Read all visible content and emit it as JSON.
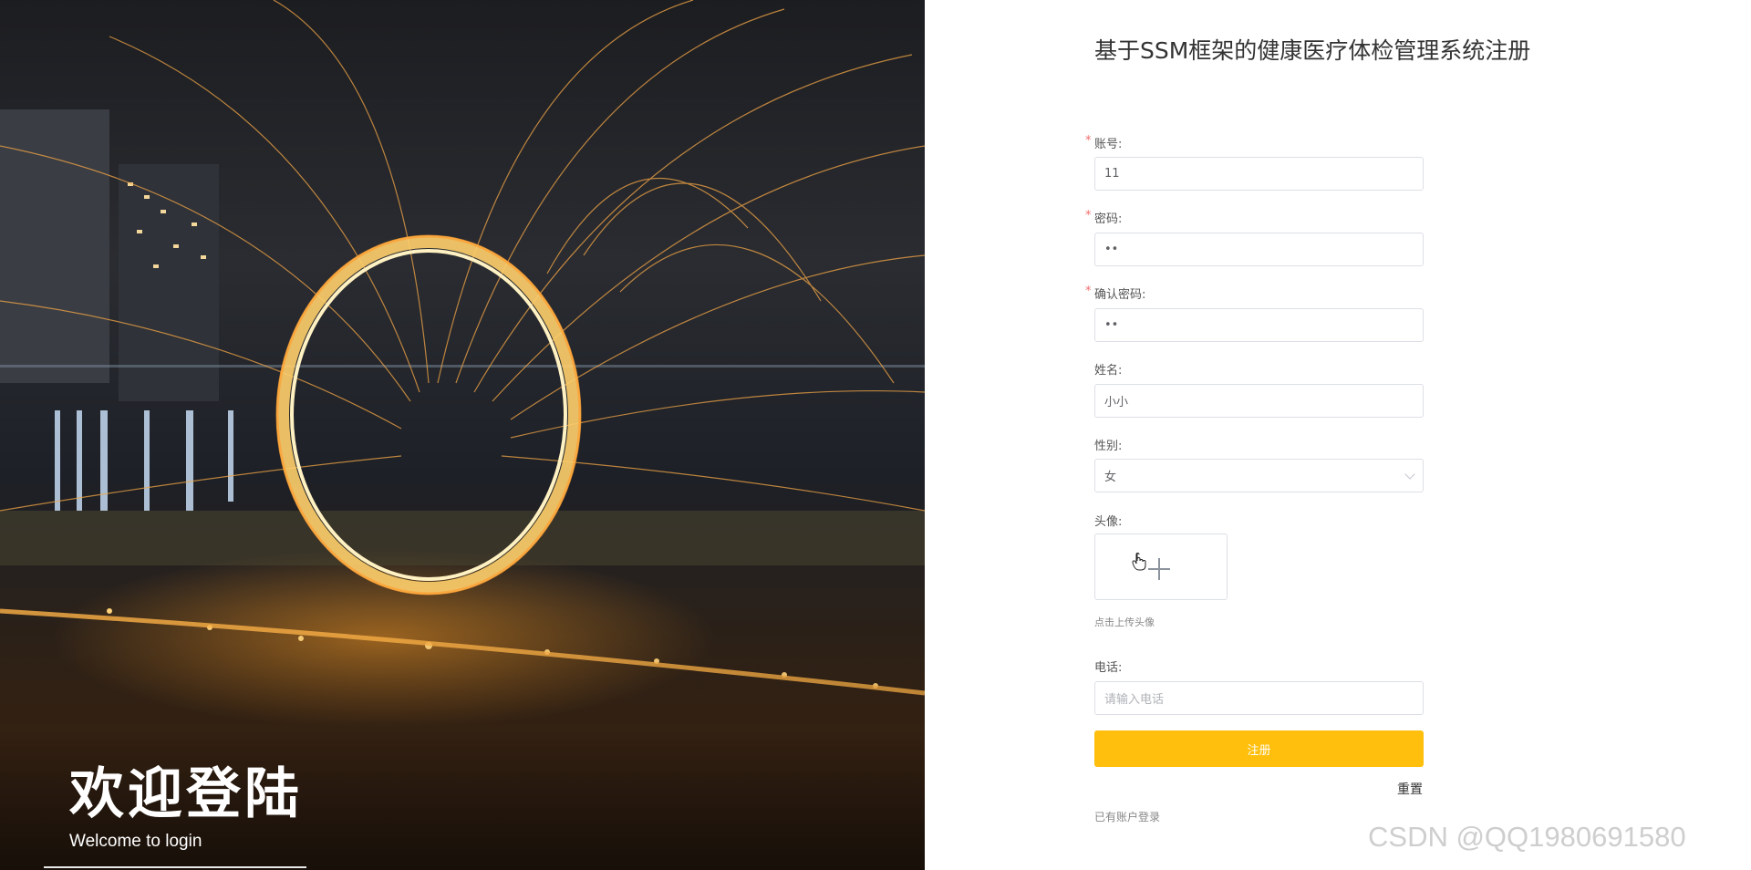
{
  "hero": {
    "welcome_title": "欢迎登陆",
    "welcome_subtitle": "Welcome to login",
    "image_subject": "steel-wool-sparks-ring"
  },
  "form": {
    "title": "基于SSM框架的健康医疗体检管理系统注册",
    "fields": {
      "account": {
        "label": "账号:",
        "required": true,
        "value": "11"
      },
      "password": {
        "label": "密码:",
        "required": true,
        "value": "••"
      },
      "confirm_password": {
        "label": "确认密码:",
        "required": true,
        "value": "••"
      },
      "name": {
        "label": "姓名:",
        "required": false,
        "value": "小小"
      },
      "gender": {
        "label": "性别:",
        "required": false,
        "value": "女"
      },
      "avatar": {
        "label": "头像:",
        "required": false,
        "hint": "点击上传头像"
      },
      "phone": {
        "label": "电话:",
        "required": false,
        "placeholder": "请输入电话",
        "value": ""
      }
    },
    "required_mark": "*",
    "submit_label": "注册",
    "reset_label": "重置",
    "login_link": "已有账户登录"
  },
  "watermark": "CSDN @QQ1980691580",
  "colors": {
    "accent": "#ffbf0c",
    "required": "#f56c6c",
    "border": "#dcdfe6"
  }
}
